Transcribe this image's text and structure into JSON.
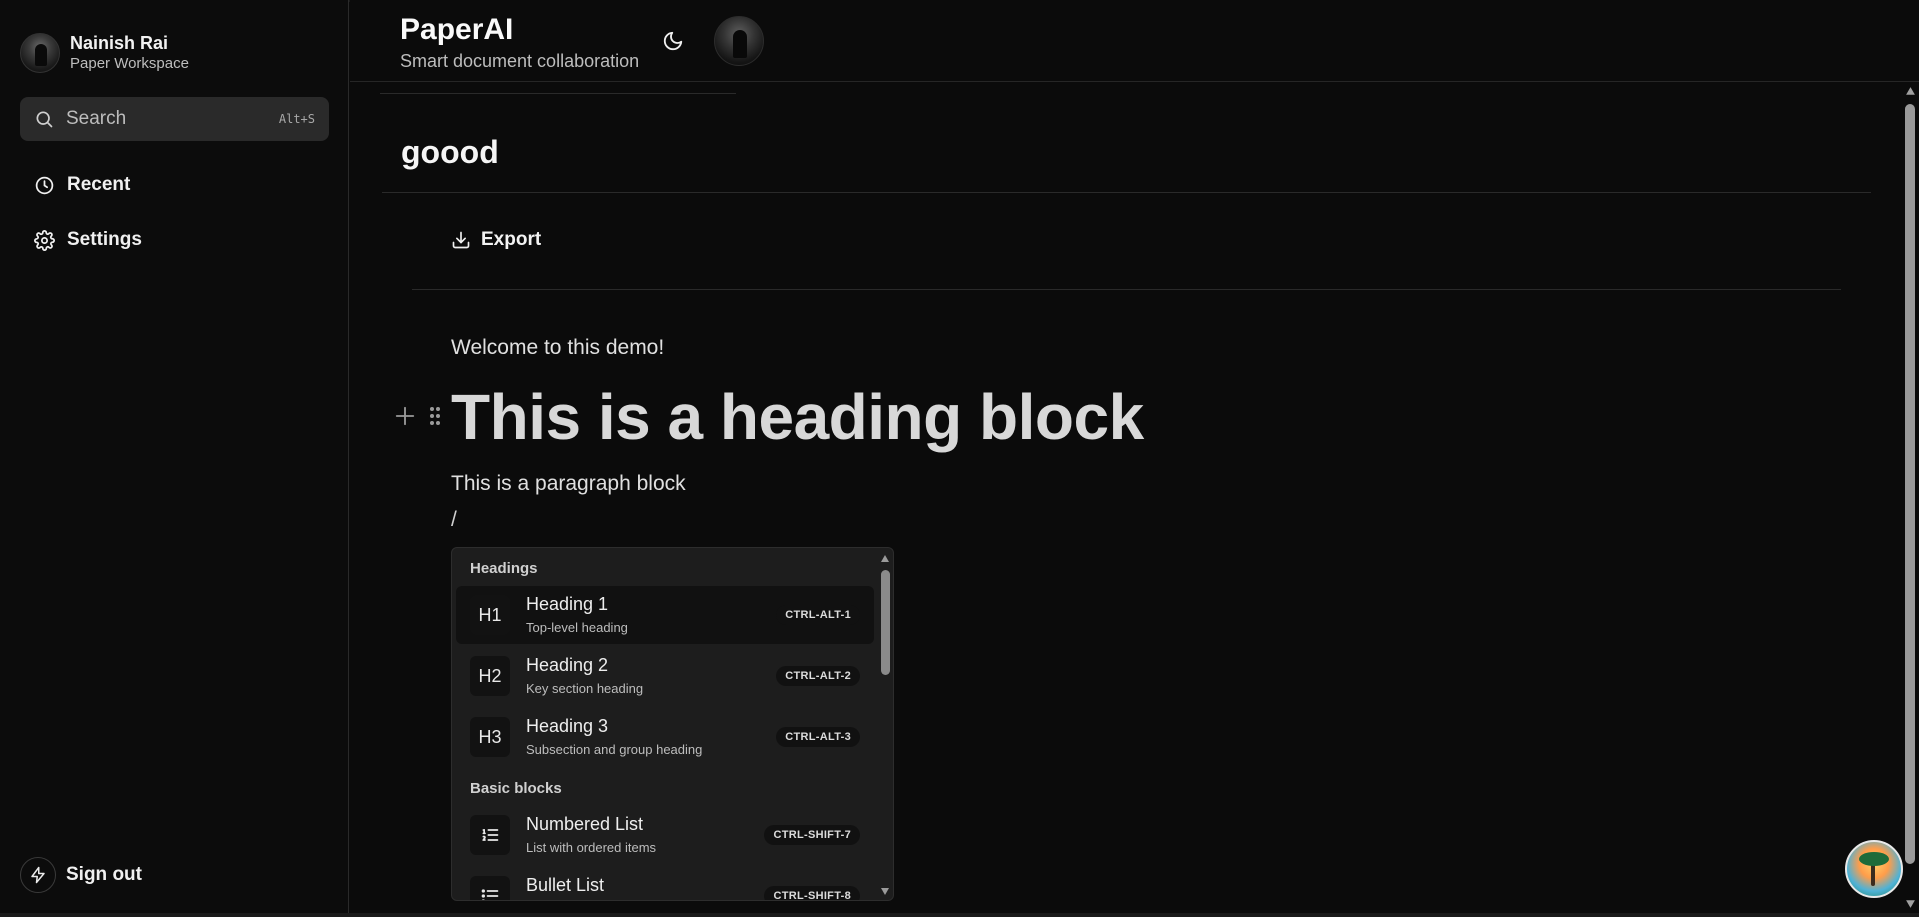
{
  "sidebar": {
    "user_name": "Nainish Rai",
    "workspace": "Paper Workspace",
    "search": {
      "label": "Search",
      "shortcut": "Alt+S"
    },
    "nav": [
      {
        "label": "Recent",
        "icon": "clock-icon"
      },
      {
        "label": "Settings",
        "icon": "gear-icon"
      }
    ],
    "signout_label": "Sign out"
  },
  "header": {
    "app_title": "PaperAI",
    "app_subtitle": "Smart document collaboration"
  },
  "document": {
    "title": "goood",
    "export_label": "Export",
    "blocks": {
      "welcome": "Welcome to this demo!",
      "heading": "This is a heading block",
      "paragraph": "This is a paragraph block",
      "slash": "/"
    }
  },
  "slash_menu": {
    "groups": [
      "Headings",
      "Basic blocks"
    ],
    "items": [
      {
        "icon_text": "H1",
        "title": "Heading 1",
        "subtitle": "Top-level heading",
        "shortcut": "CTRL-ALT-1"
      },
      {
        "icon_text": "H2",
        "title": "Heading 2",
        "subtitle": "Key section heading",
        "shortcut": "CTRL-ALT-2"
      },
      {
        "icon_text": "H3",
        "title": "Heading 3",
        "subtitle": "Subsection and group heading",
        "shortcut": "CTRL-ALT-3"
      },
      {
        "icon_text": "",
        "title": "Numbered List",
        "subtitle": "List with ordered items",
        "shortcut": "CTRL-SHIFT-7"
      },
      {
        "icon_text": "",
        "title": "Bullet List",
        "subtitle": "",
        "shortcut": "CTRL-SHIFT-8"
      }
    ]
  },
  "colors": {
    "background": "#0b0b0b",
    "menu_bg": "#1d1d1d",
    "active_item": "#111111",
    "text": "#e6e6e6"
  }
}
